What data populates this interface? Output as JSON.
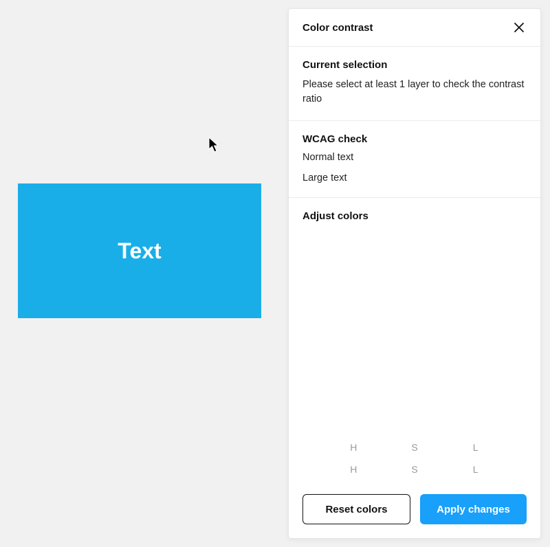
{
  "canvas": {
    "text": "Text",
    "bg_color": "#1aaee8",
    "text_color": "#ffffff"
  },
  "panel": {
    "title": "Color contrast",
    "sections": {
      "current_selection": {
        "title": "Current selection",
        "description": "Please select at least 1 layer to check the contrast ratio"
      },
      "wcag": {
        "title": "WCAG check",
        "items": [
          "Normal text",
          "Large text"
        ]
      },
      "adjust": {
        "title": "Adjust colors",
        "row1": [
          "H",
          "S",
          "L"
        ],
        "row2": [
          "H",
          "S",
          "L"
        ]
      }
    },
    "buttons": {
      "reset": "Reset colors",
      "apply": "Apply changes"
    }
  }
}
